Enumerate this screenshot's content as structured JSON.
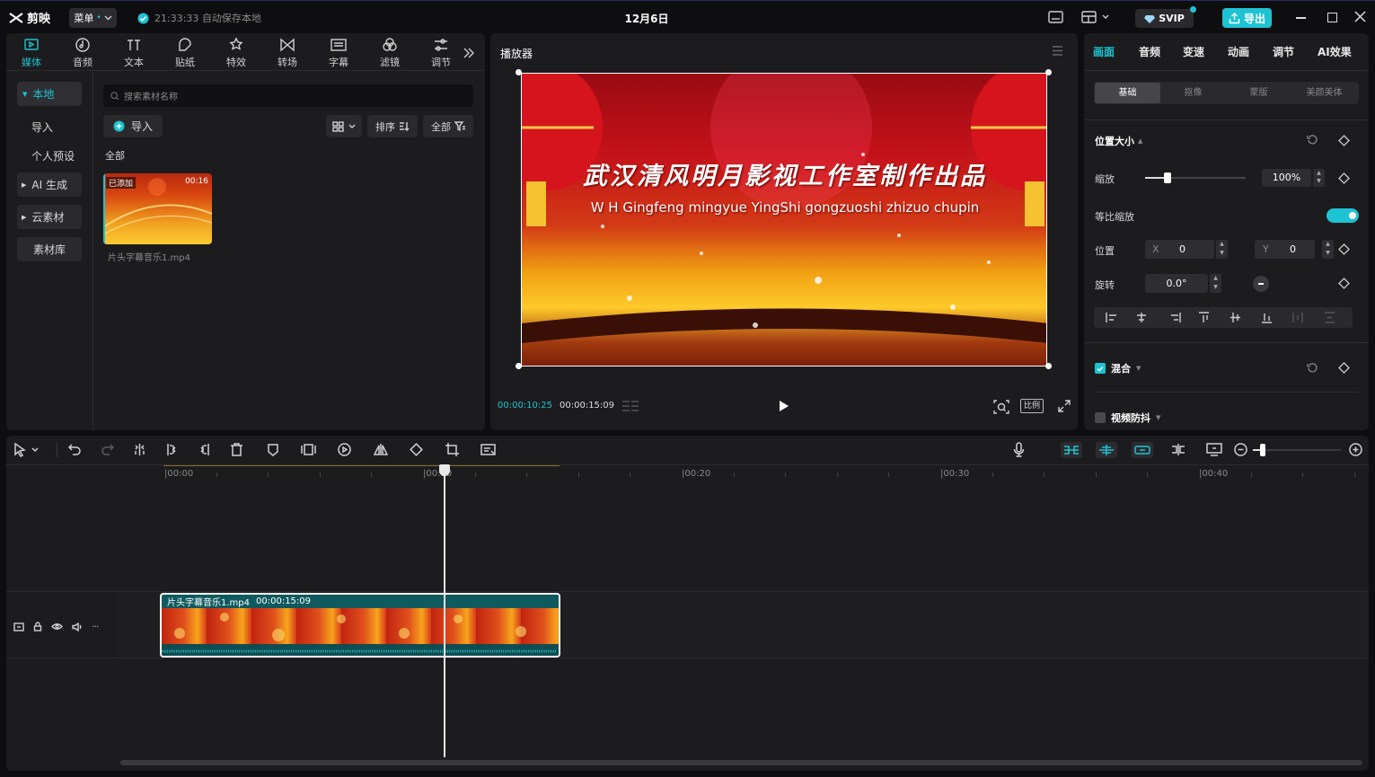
{
  "titlebar": {
    "logo_text": "剪映",
    "menu_label": "菜单",
    "autosave_text": "21:33:33 自动保存本地",
    "project_title": "12月6日",
    "svip_label": "SVIP",
    "export_label": "导出"
  },
  "media_tabs": [
    {
      "label": "媒体",
      "icon": "media-icon"
    },
    {
      "label": "音频",
      "icon": "audio-icon"
    },
    {
      "label": "文本",
      "icon": "text-icon"
    },
    {
      "label": "贴纸",
      "icon": "sticker-icon"
    },
    {
      "label": "特效",
      "icon": "effects-icon"
    },
    {
      "label": "转场",
      "icon": "transition-icon"
    },
    {
      "label": "字幕",
      "icon": "subtitle-icon"
    },
    {
      "label": "滤镜",
      "icon": "filter-icon"
    },
    {
      "label": "调节",
      "icon": "adjust-icon"
    }
  ],
  "media_sidebar": {
    "local": "本地",
    "import": "导入",
    "preset": "个人预设",
    "ai": "AI 生成",
    "cloud": "云素材",
    "library": "素材库"
  },
  "media_main": {
    "search_placeholder": "搜索素材名称",
    "import_button": "导入",
    "sort_label": "排序",
    "filter_label": "全部",
    "section_label": "全部",
    "clip": {
      "badge": "已添加",
      "duration": "00:16",
      "name": "片头字幕音乐1.mp4"
    }
  },
  "player": {
    "title": "播放器",
    "video_title_cn": "武汉清风明月影视工作室制作出品",
    "video_title_en": "W H Gingfeng mingyue YingShi gongzuoshi zhizuo chupin",
    "current_time": "00:00:10:25",
    "total_time": "00:00:15:09",
    "ratio_label": "比例"
  },
  "inspector": {
    "tabs": [
      "画面",
      "音频",
      "变速",
      "动画",
      "调节",
      "AI效果"
    ],
    "subtabs": [
      "基础",
      "抠像",
      "蒙版",
      "美颜美体"
    ],
    "section_position": "位置大小",
    "scale_label": "缩放",
    "scale_value": "100%",
    "scale_fraction": 0.22,
    "proportional_label": "等比缩放",
    "position_label": "位置",
    "x_label": "X",
    "x_value": "0",
    "y_label": "Y",
    "y_value": "0",
    "rotate_label": "旋转",
    "rotate_value": "0.0°",
    "blend_label": "混合",
    "stabilize_label": "视频防抖"
  },
  "timeline": {
    "ruler": [
      "|00:00",
      "|00:10",
      "|00:20",
      "|00:30",
      "|00:40"
    ],
    "cover_label": "封面",
    "clip_label": "片头字幕音乐1.mp4",
    "clip_duration": "00:00:15:09",
    "playhead_seconds": 10.8
  },
  "colors": {
    "accent": "#1ec3d3",
    "bg": "#1c1c1e",
    "clip_teal": "#0f5a5e"
  }
}
